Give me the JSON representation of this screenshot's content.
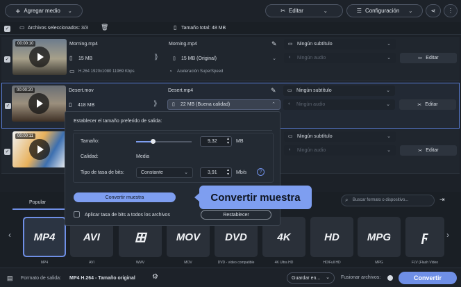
{
  "toolbar": {
    "add_media": "Agregar medio",
    "edit": "Editar",
    "settings": "Configuración"
  },
  "status": {
    "selected_files": "Archivos seleccionados: 3/3",
    "total_size": "Tamaño total: 48 MB"
  },
  "files": [
    {
      "duration": "00:00:10",
      "name": "Morning.mp4",
      "size": "15 MB",
      "codec": "H.264 1920x1080 11969 Kbps",
      "output_name": "Morning.mp4",
      "output_size": "15 MB (Original)",
      "note": "Aceleración SuperSpeed",
      "subtitle": "Ningún subtítulo",
      "audio": "Ningún audio",
      "edit": "Editar"
    },
    {
      "duration": "00:00:20",
      "name": "Desert.mov",
      "size": "418 MB",
      "output_name": "Desert.mp4",
      "output_size": "22 MB (Buena calidad)",
      "subtitle": "Ningún subtítulo",
      "audio": "Ningún audio",
      "edit": "Editar"
    },
    {
      "duration": "00:00:11",
      "subtitle": "Ningún subtítulo",
      "audio": "Ningún audio",
      "edit": "Editar"
    }
  ],
  "popup": {
    "heading": "Establecer el tamaño preferido de salida:",
    "size_label": "Tamaño:",
    "size_value": "9,32",
    "size_unit": "MB",
    "size_slider_fraction": 0.3,
    "quality_label": "Calidad:",
    "quality_value": "Media",
    "bitrate_type_label": "Tipo de tasa de bits:",
    "bitrate_type_value": "Constante",
    "bitrate_value": "3,91",
    "bitrate_unit": "Mb/s",
    "convert_sample": "Convertir muestra",
    "apply_all": "Aplicar tasa de bits a todos los archivos",
    "reset": "Restablecer"
  },
  "tooltip": "Convertir muestra",
  "formats": {
    "tab": "Popular",
    "search_placeholder": "Buscar formato o dispositivo...",
    "items": [
      {
        "icon": "MP4",
        "label": "MP4"
      },
      {
        "icon": "AVI",
        "label": "AVI"
      },
      {
        "icon": "",
        "label": "WMV"
      },
      {
        "icon": "MOV",
        "label": "MOV"
      },
      {
        "icon": "DVD",
        "label": "DVD - vídeo compatible"
      },
      {
        "icon": "4K",
        "label": "4K Ultra HD"
      },
      {
        "icon": "HD",
        "label": "HD/Full HD"
      },
      {
        "icon": "MPG",
        "label": "MPG"
      },
      {
        "icon": "",
        "label": "FLV (Flash Video"
      }
    ]
  },
  "footer": {
    "output_format_label": "Formato de salida:",
    "output_format_value": "MP4 H.264 - Tamaño original",
    "save_to": "Guardar en...",
    "merge": "Fusionar archivos:",
    "convert": "Convertir"
  },
  "colors": {
    "accent": "#7e9ef0",
    "convert_button": "#6f8fe6",
    "background": "#1c2128"
  }
}
